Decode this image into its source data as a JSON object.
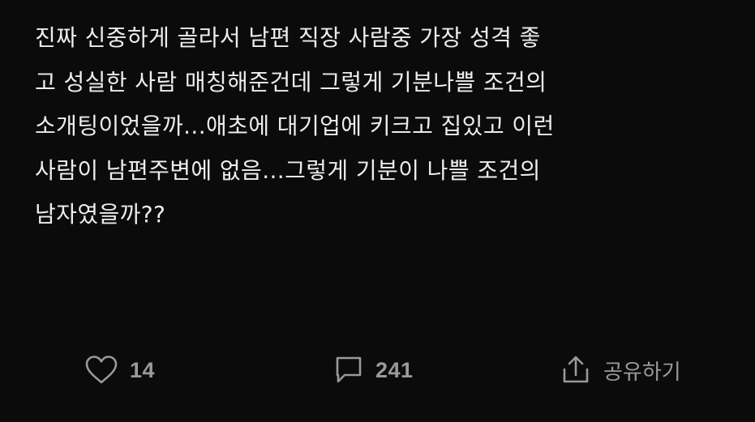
{
  "post": {
    "lines": [
      "진짜 신중하게 골라서 남편 직장 사람중 가장 성격 좋",
      "고 성실한 사람 매칭해준건데 그렇게 기분나쁠 조건의",
      "소개팅이었을까...애초에 대기업에 키크고 집있고 이런",
      "사람이 남편주변에 없음...그렇게 기분이 나쁠 조건의",
      "남자였을까??"
    ]
  },
  "actions": {
    "like_count": "14",
    "comment_count": "241",
    "share_label": "공유하기"
  },
  "icons": {
    "like": "heart-icon",
    "comment": "comment-icon",
    "share": "share-icon"
  },
  "colors": {
    "background": "#0b0b0b",
    "text": "#ededed",
    "muted": "#9a9a9a"
  }
}
